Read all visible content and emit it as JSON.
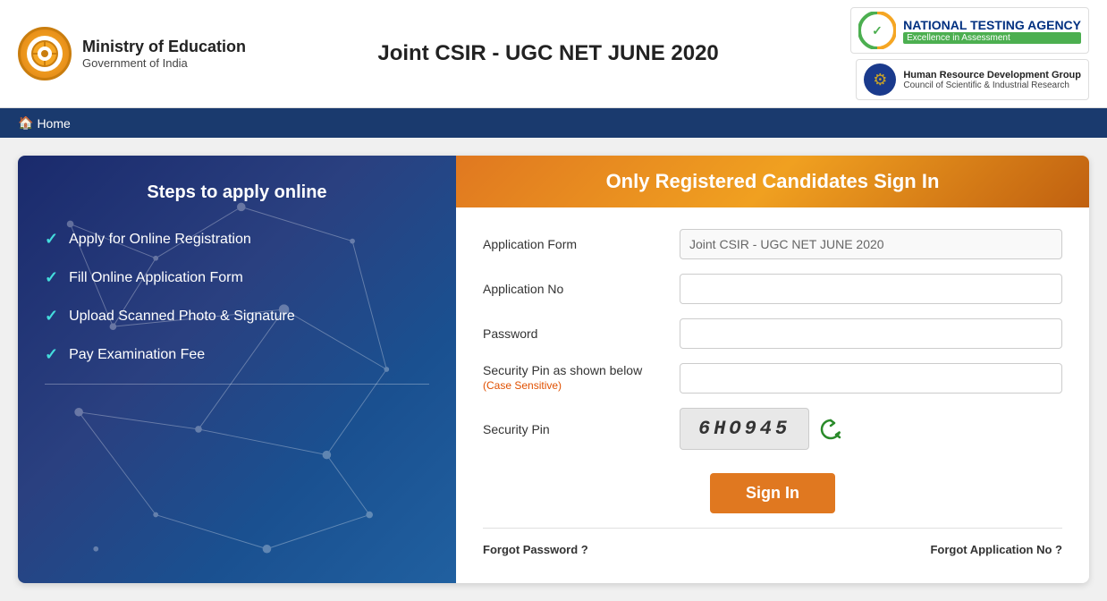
{
  "header": {
    "logo_symbol": "🏛",
    "org_name": "Ministry of Education",
    "org_sub": "Government of India",
    "page_title": "Joint CSIR - UGC NET JUNE 2020",
    "nta_name": "NATIONAL TESTING AGENCY",
    "nta_tagline": "Excellence in Assessment",
    "csir_line1": "Human Resource Development Group",
    "csir_line2": "Council of Scientific & Industrial Research"
  },
  "nav": {
    "home_label": "Home",
    "home_icon": "🏠"
  },
  "steps_panel": {
    "title": "Steps to apply online",
    "steps": [
      "Apply for Online Registration",
      "Fill Online Application Form",
      "Upload Scanned Photo & Signature",
      "Pay Examination Fee"
    ]
  },
  "signin_panel": {
    "header": "Only Registered Candidates Sign In",
    "fields": {
      "application_form_label": "Application Form",
      "application_form_value": "Joint CSIR - UGC NET JUNE 2020",
      "application_form_placeholder": "Joint CSIR - UGC NET JUNE 2020",
      "application_no_label": "Application No",
      "application_no_placeholder": "",
      "password_label": "Password",
      "password_placeholder": "",
      "security_pin_label1": "Security Pin as shown below",
      "case_sensitive_note": "(Case Sensitive)",
      "security_pin_label2": "Security Pin",
      "captcha_value": "6HO945"
    },
    "sign_in_button": "Sign In",
    "forgot_password": "Forgot Password ?",
    "forgot_application_no": "Forgot Application No ?"
  }
}
